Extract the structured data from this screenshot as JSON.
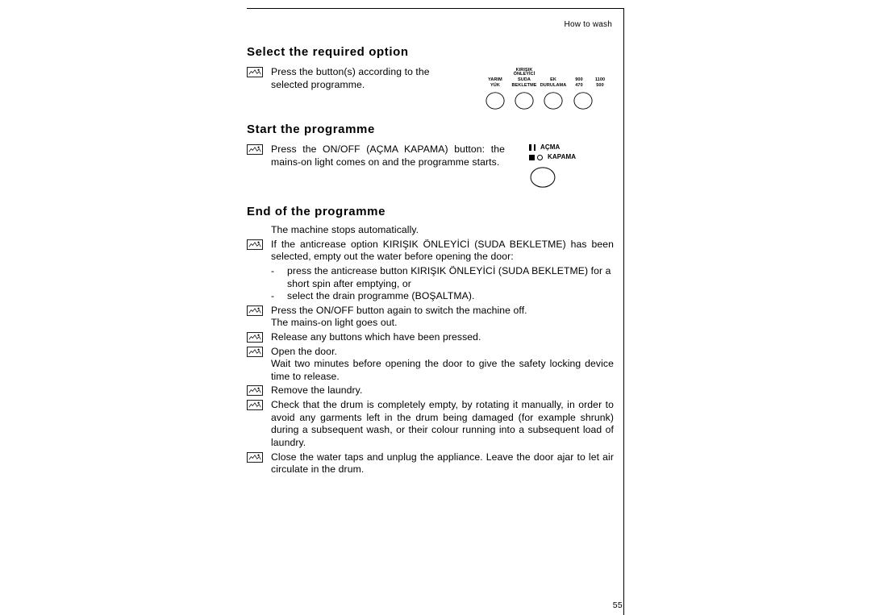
{
  "header": {
    "section": "How to wash",
    "page_number": "55"
  },
  "section1": {
    "heading": "Select the required option",
    "item1": "Press the button(s) according to the selected programme.",
    "options": {
      "col1": {
        "top": "",
        "line1": "YARIM",
        "line2": "YÜK"
      },
      "col2": {
        "top": "KIRIŞIK\nÖNLEYİCİ",
        "line1": "SUDA",
        "line2": "BEKLETME"
      },
      "col3": {
        "top": "",
        "line1": "EK",
        "line2": "DURULAMA"
      },
      "col4": {
        "top": "",
        "line1": "900",
        "line2": "470"
      },
      "col5": {
        "top": "",
        "line1": "1100",
        "line2": "500"
      }
    }
  },
  "section2": {
    "heading": "Start the programme",
    "item1": "Press the ON/OFF (AÇMA KAPAMA) button: the mains-on light comes on and the programme starts.",
    "onoff": {
      "on_label": "AÇMA",
      "off_label": "KAPAMA"
    }
  },
  "section3": {
    "heading": "End of the programme",
    "intro": "The machine stops automatically.",
    "item1": "If the anticrease option KIRIŞIK ÖNLEYİCİ (SUDA BEKLETME) has been selected, empty out the water before opening the door:",
    "sub1": "press the anticrease button KIRIŞIK ÖNLEYİCİ (SUDA BEKLETME) for a short spin after emptying, or",
    "sub2": "select the drain programme (BOŞALTMA).",
    "item2a": "Press the ON/OFF button again to switch the machine off.",
    "item2b": "The mains-on light goes out.",
    "item3": "Release any buttons which have been pressed.",
    "item4a": "Open the door.",
    "item4b": "Wait two minutes before opening the door to give the safety locking device time to release.",
    "item5": "Remove the laundry.",
    "item6": "Check that the drum is completely empty, by rotating it manually, in order to avoid any garments left in the drum being damaged (for example shrunk) during a subsequent wash, or their colour running into a subsequent load of laundry.",
    "item7": "Close the water taps and unplug the appliance. Leave the door ajar to let air circulate in the drum."
  }
}
